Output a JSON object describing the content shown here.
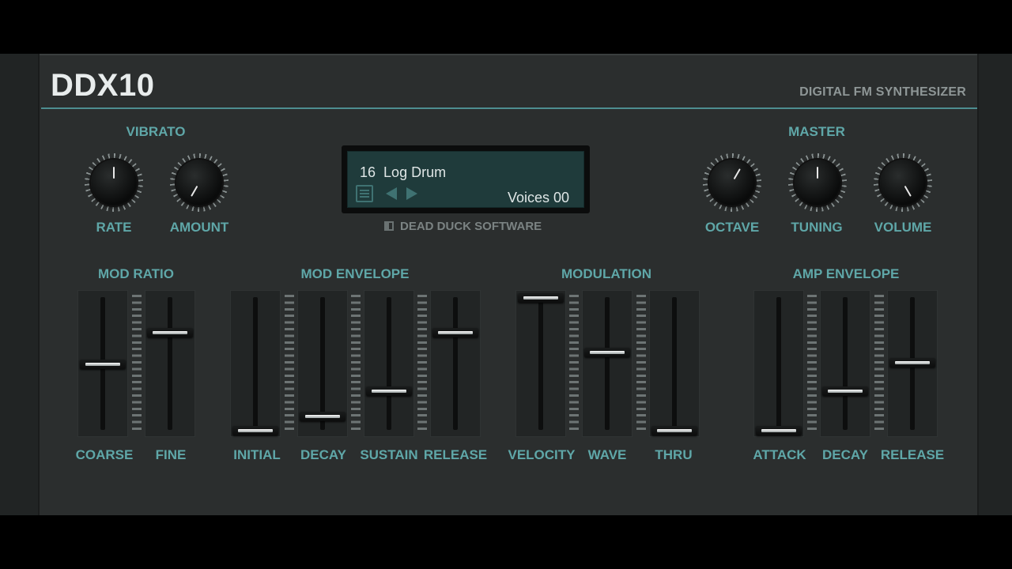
{
  "header": {
    "title": "DDX10",
    "subtitle": "DIGITAL FM SYNTHESIZER"
  },
  "vibrato": {
    "section_label": "VIBRATO",
    "knobs": [
      {
        "label": "RATE",
        "angle_deg": 0
      },
      {
        "label": "AMOUNT",
        "angle_deg": -150
      }
    ]
  },
  "master": {
    "section_label": "MASTER",
    "knobs": [
      {
        "label": "OCTAVE",
        "angle_deg": 30
      },
      {
        "label": "TUNING",
        "angle_deg": 0
      },
      {
        "label": "VOLUME",
        "angle_deg": 150
      }
    ]
  },
  "display": {
    "preset_number": "16",
    "preset_name": "Log Drum",
    "voices_text": "Voices 00",
    "brand": "DEAD DUCK SOFTWARE"
  },
  "mod_ratio": {
    "section_label": "MOD RATIO",
    "sliders": [
      {
        "label": "COARSE",
        "value": 0.5
      },
      {
        "label": "FINE",
        "value": 0.74
      }
    ]
  },
  "mod_envelope": {
    "section_label": "MOD ENVELOPE",
    "sliders": [
      {
        "label": "INITIAL",
        "value": 0.0
      },
      {
        "label": "DECAY",
        "value": 0.11
      },
      {
        "label": "SUSTAIN",
        "value": 0.3
      },
      {
        "label": "RELEASE",
        "value": 0.74
      }
    ]
  },
  "modulation": {
    "section_label": "MODULATION",
    "sliders": [
      {
        "label": "VELOCITY",
        "value": 1.0
      },
      {
        "label": "WAVE",
        "value": 0.59
      },
      {
        "label": "THRU",
        "value": 0.0
      }
    ]
  },
  "amp_envelope": {
    "section_label": "AMP ENVELOPE",
    "sliders": [
      {
        "label": "ATTACK",
        "value": 0.0
      },
      {
        "label": "DECAY",
        "value": 0.3
      },
      {
        "label": "RELEASE",
        "value": 0.51
      }
    ]
  },
  "colors": {
    "accent": "#5fa7a8",
    "panel": "#2b2e2e",
    "lcd": "#1f3b3b"
  }
}
